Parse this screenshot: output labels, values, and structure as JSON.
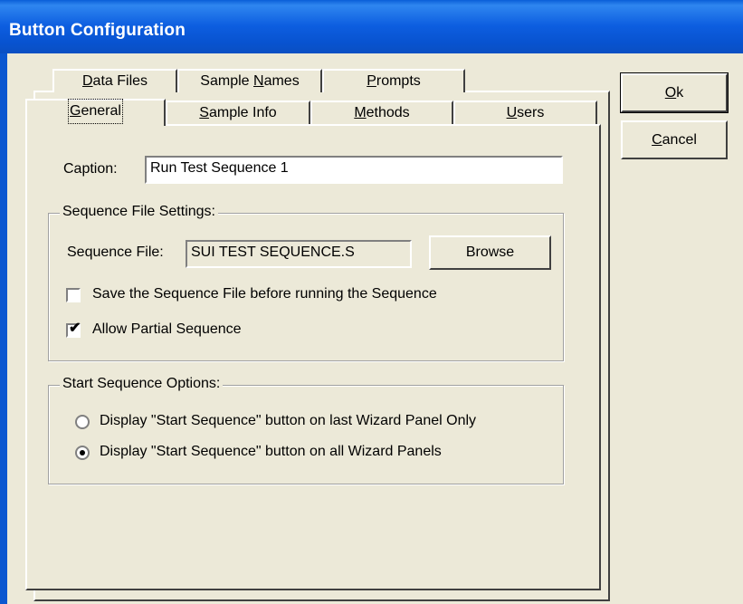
{
  "window": {
    "title": "Button Configuration"
  },
  "tabs": {
    "back_row": [
      {
        "label_pre": "",
        "mnemonic": "D",
        "label_post": "ata Files"
      },
      {
        "label_pre": "Sample ",
        "mnemonic": "N",
        "label_post": "ames"
      },
      {
        "label_pre": "",
        "mnemonic": "P",
        "label_post": "rompts"
      }
    ],
    "front_row": [
      {
        "label_pre": "",
        "mnemonic": "G",
        "label_post": "eneral",
        "active": true
      },
      {
        "label_pre": "",
        "mnemonic": "S",
        "label_post": "ample Info"
      },
      {
        "label_pre": "",
        "mnemonic": "M",
        "label_post": "ethods"
      },
      {
        "label_pre": "",
        "mnemonic": "U",
        "label_post": "sers"
      }
    ]
  },
  "general": {
    "caption_label": "Caption:",
    "caption_value": "Run Test Sequence 1",
    "sequence_group": {
      "title": "Sequence File Settings:",
      "file_label": "Sequence File:",
      "file_value": "SUI TEST SEQUENCE.S",
      "browse_label": "Browse",
      "save_before_label": "Save the Sequence File before running the Sequence",
      "save_before_checked": false,
      "allow_partial_label": "Allow Partial Sequence",
      "allow_partial_checked": true
    },
    "start_group": {
      "title": "Start Sequence Options:",
      "option_last_label": "Display \"Start Sequence\" button on last Wizard Panel Only",
      "option_all_label": "Display \"Start Sequence\" button on all Wizard Panels",
      "selected": "all"
    }
  },
  "buttons": {
    "ok": {
      "mnemonic": "O",
      "rest": "k"
    },
    "cancel": {
      "mnemonic": "C",
      "rest": "ancel"
    }
  }
}
